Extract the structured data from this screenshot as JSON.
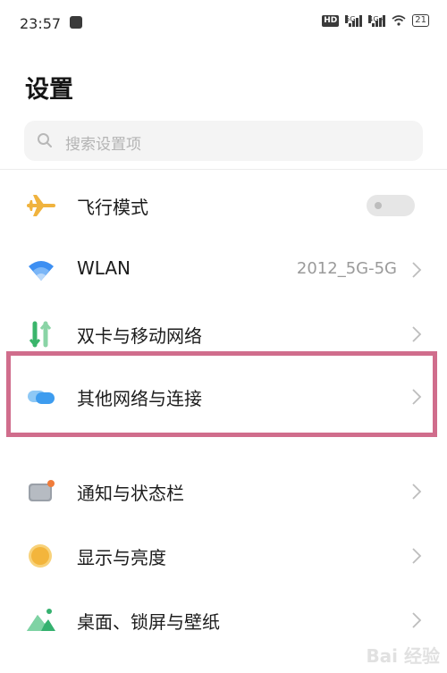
{
  "status_bar": {
    "time": "23:57",
    "hd_badge": "HD",
    "network_1": "5G",
    "network_2": "4G+",
    "battery": "21"
  },
  "page": {
    "title": "设置"
  },
  "search": {
    "placeholder": "搜索设置项"
  },
  "settings": {
    "items": [
      {
        "label": "飞行模式",
        "icon": "airplane-icon",
        "type": "toggle",
        "value": ""
      },
      {
        "label": "WLAN",
        "icon": "wifi-icon",
        "type": "link",
        "value": "2012_5G-5G"
      },
      {
        "label": "双卡与移动网络",
        "icon": "dual-sim-icon",
        "type": "link",
        "value": ""
      },
      {
        "label": "其他网络与连接",
        "icon": "connection-icon",
        "type": "link",
        "value": ""
      },
      {
        "label": "通知与状态栏",
        "icon": "notification-icon",
        "type": "link",
        "value": ""
      },
      {
        "label": "显示与亮度",
        "icon": "brightness-icon",
        "type": "link",
        "value": ""
      },
      {
        "label": "桌面、锁屏与壁纸",
        "icon": "wallpaper-icon",
        "type": "link",
        "value": ""
      }
    ]
  },
  "colors": {
    "highlight_border": "#d06d8c",
    "airplane": "#f0b33e",
    "wifi": "#3d8ff2",
    "dual_sim": "#3ab56b",
    "connection": "#4aa7ee",
    "brightness": "#f3b53c",
    "wallpaper": "#35b16f"
  },
  "watermark": {
    "text": "Bai 经验"
  }
}
